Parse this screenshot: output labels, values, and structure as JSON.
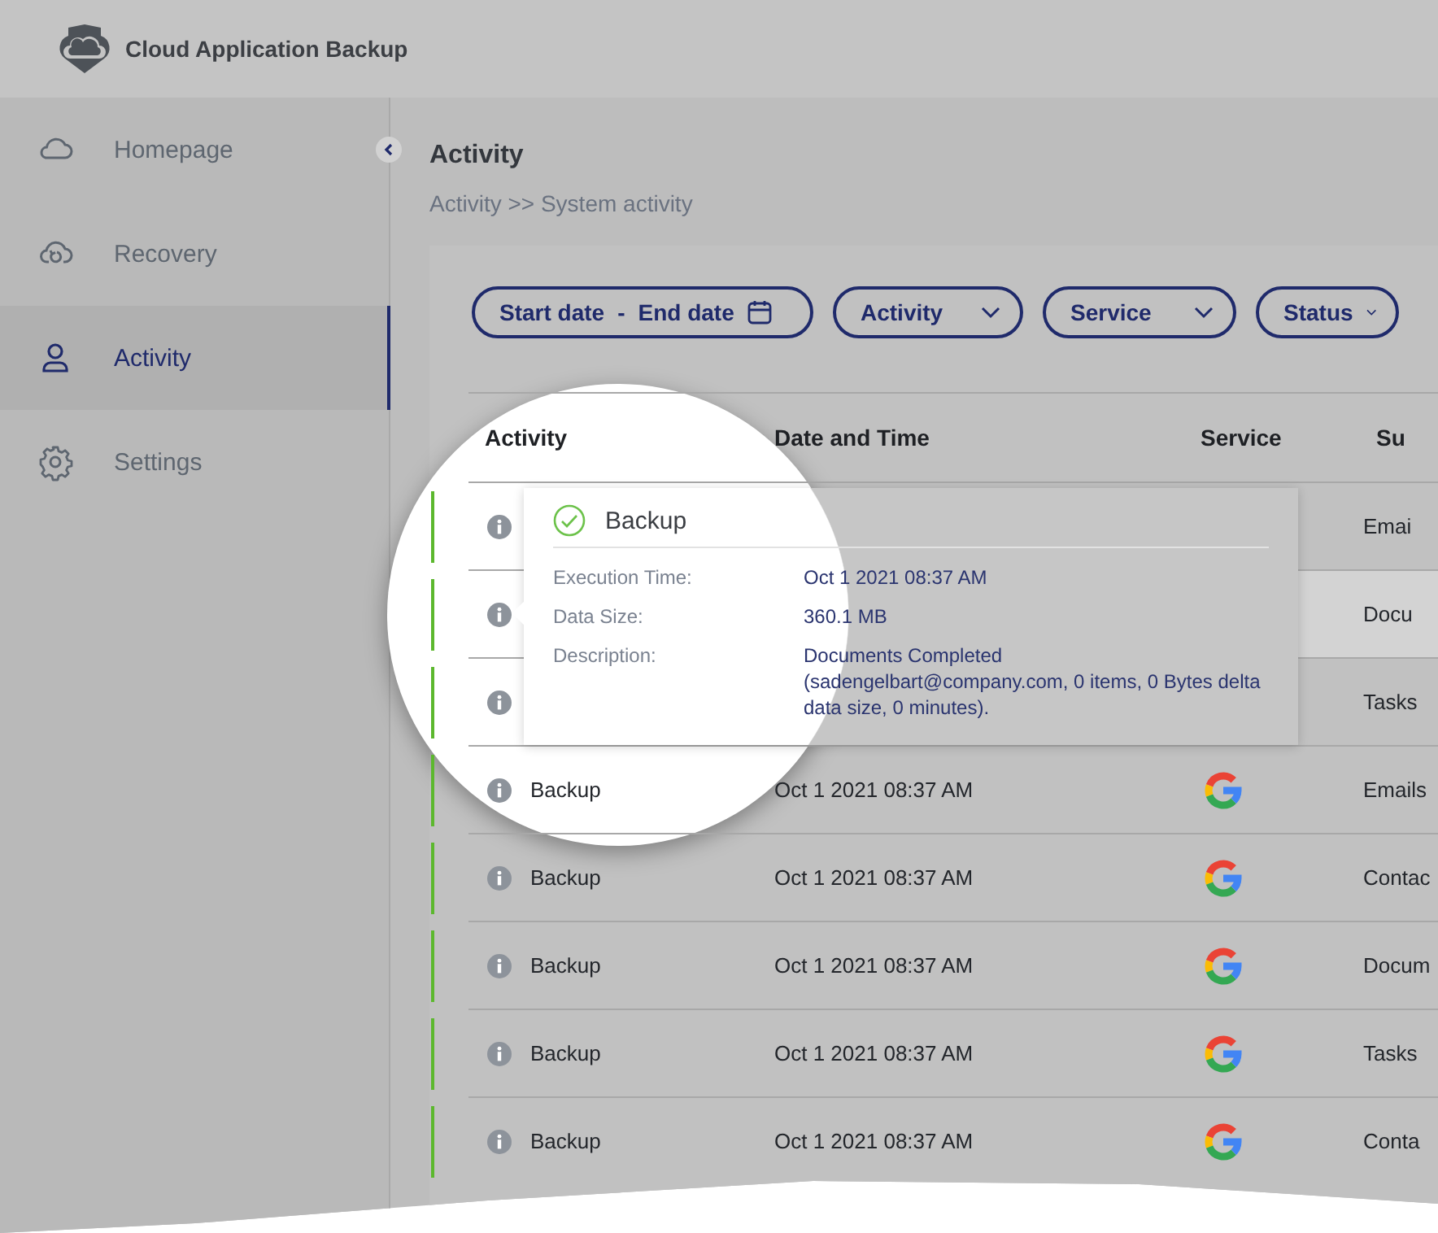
{
  "app": {
    "title": "Cloud Application Backup"
  },
  "sidebar": {
    "items": [
      {
        "label": "Homepage",
        "selected": false
      },
      {
        "label": "Recovery",
        "selected": false
      },
      {
        "label": "Activity",
        "selected": true
      },
      {
        "label": "Settings",
        "selected": false
      }
    ]
  },
  "page": {
    "title": "Activity",
    "breadcrumb": "Activity >> System activity"
  },
  "filters": [
    {
      "kind": "daterange",
      "start": "Start date",
      "separator": "-",
      "end": "End date"
    },
    {
      "kind": "dropdown",
      "label": "Activity"
    },
    {
      "kind": "dropdown",
      "label": "Service"
    },
    {
      "kind": "dropdown",
      "label": "Status"
    }
  ],
  "table": {
    "columns": [
      "Activity",
      "Date and Time",
      "Service",
      "Su"
    ],
    "rows": [
      {
        "kind": "covered",
        "subject": "Emai",
        "highlighted": false
      },
      {
        "kind": "covered",
        "subject": "Docu",
        "highlighted": true
      },
      {
        "kind": "covered",
        "subject": "Tasks",
        "highlighted": false
      },
      {
        "kind": "full",
        "activity": "Backup",
        "date_time": "Oct 1 2021 08:37 AM",
        "subject": "Emails",
        "highlighted": false
      },
      {
        "kind": "full",
        "activity": "Backup",
        "date_time": "Oct 1 2021 08:37 AM",
        "subject": "Contac",
        "highlighted": false
      },
      {
        "kind": "full",
        "activity": "Backup",
        "date_time": "Oct 1 2021 08:37 AM",
        "subject": "Docum",
        "highlighted": false
      },
      {
        "kind": "full",
        "activity": "Backup",
        "date_time": "Oct 1 2021 08:37 AM",
        "subject": "Tasks",
        "highlighted": false
      },
      {
        "kind": "full",
        "activity": "Backup",
        "date_time": "Oct 1 2021 08:37 AM",
        "subject": "Conta",
        "highlighted": false
      }
    ]
  },
  "tooltip": {
    "title": "Backup",
    "fields": [
      {
        "label": "Execution Time:",
        "value": "Oct 1 2021 08:37 AM"
      },
      {
        "label": "Data Size:",
        "value": "360.1 MB"
      },
      {
        "label": "Description:",
        "value": "Documents Completed (sadengelbart@company.com, 0 items, 0 Bytes delta data size, 0 minutes)."
      }
    ]
  }
}
